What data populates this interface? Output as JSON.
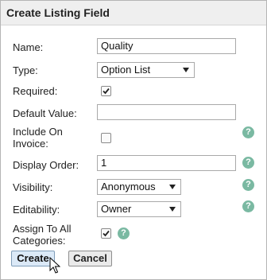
{
  "dialog": {
    "title": "Create Listing Field"
  },
  "fields": {
    "name": {
      "label": "Name:",
      "value": "Quality"
    },
    "type": {
      "label": "Type:",
      "selected": "Option List"
    },
    "required": {
      "label": "Required:",
      "checked": true
    },
    "default_value": {
      "label": "Default Value:",
      "value": ""
    },
    "include_on_invoice": {
      "label_line1": "Include On",
      "label_line2": "Invoice:",
      "checked": false
    },
    "display_order": {
      "label": "Display Order:",
      "value": "1"
    },
    "visibility": {
      "label": "Visibility:",
      "selected": "Anonymous"
    },
    "editability": {
      "label": "Editability:",
      "selected": "Owner"
    },
    "assign_to_all": {
      "label_line1": "Assign To All",
      "label_line2": "Categories:",
      "checked": true
    }
  },
  "help_icon_glyph": "?",
  "buttons": {
    "create": "Create",
    "cancel": "Cancel"
  },
  "colors": {
    "help_icon": "#7ab9a2",
    "create_button_bg": "#dbe9f7"
  }
}
